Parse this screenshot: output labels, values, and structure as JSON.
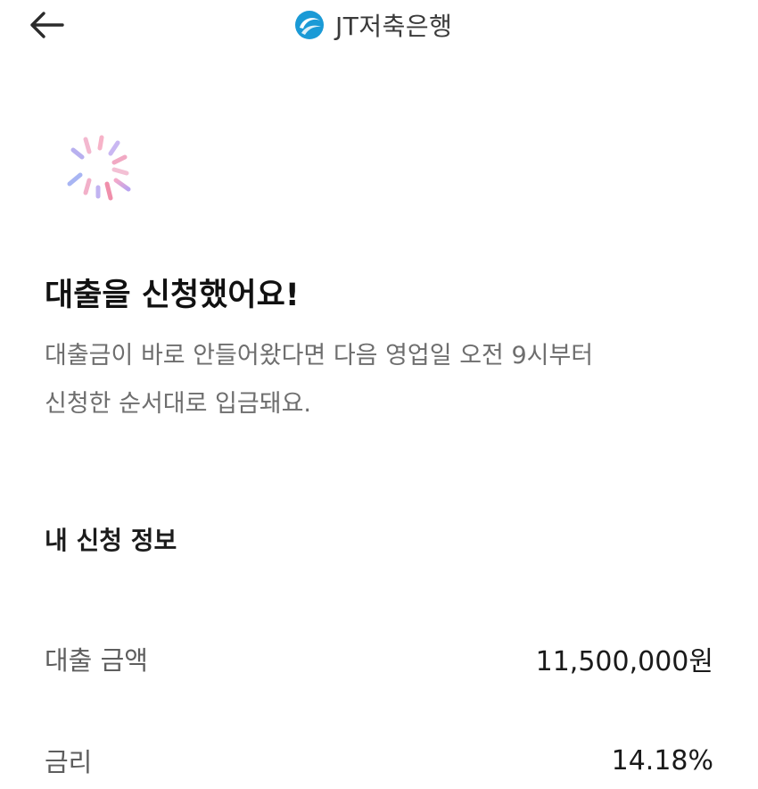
{
  "header": {
    "brand_name": "JT저축은행",
    "brand_color": "#1a9ad6"
  },
  "result": {
    "title": "대출을 신청했어요!",
    "description_line1": "대출금이 바로 안들어왔다면 다음 영업일 오전 9시부터",
    "description_line2": "신청한 순서대로 입금돼요."
  },
  "application_info": {
    "section_title": "내 신청 정보",
    "rows": [
      {
        "label": "대출 금액",
        "value": "11,500,000원"
      },
      {
        "label": "금리",
        "value": "14.18%"
      }
    ]
  }
}
